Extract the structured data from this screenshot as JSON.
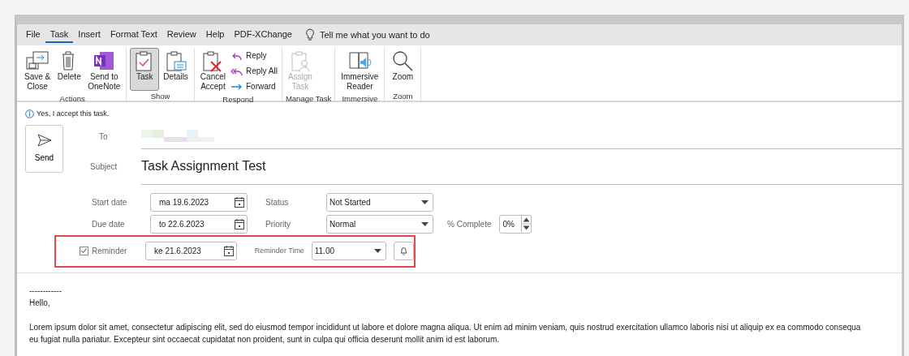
{
  "menu_tabs": [
    {
      "label": "File",
      "selected": false
    },
    {
      "label": "Task",
      "selected": true
    },
    {
      "label": "Insert",
      "selected": false
    },
    {
      "label": "Format Text",
      "selected": false
    },
    {
      "label": "Review",
      "selected": false
    },
    {
      "label": "Help",
      "selected": false
    },
    {
      "label": "PDF-XChange",
      "selected": false
    }
  ],
  "tell_me": {
    "placeholder": "Tell me what you want to do"
  },
  "ribbon_groups": [
    {
      "label": "Actions",
      "buttons": [
        {
          "kind": "large",
          "label": "Save &\nClose",
          "selected": false,
          "disabled": false
        },
        {
          "kind": "large",
          "label": "Delete",
          "selected": false,
          "disabled": false
        },
        {
          "kind": "large",
          "label": "Send to\nOneNote",
          "selected": false,
          "disabled": false
        }
      ]
    },
    {
      "label": "Show",
      "buttons": [
        {
          "kind": "large",
          "label": "Task",
          "selected": true,
          "disabled": false
        },
        {
          "kind": "large",
          "label": "Details",
          "selected": false,
          "disabled": false
        }
      ]
    },
    {
      "label": "Respond",
      "buttons": [
        {
          "kind": "large",
          "label": "Cancel\nAccept",
          "selected": false,
          "disabled": false
        },
        {
          "kind": "small",
          "label": "Reply"
        },
        {
          "kind": "small",
          "label": "Reply All"
        },
        {
          "kind": "small",
          "label": "Forward"
        }
      ]
    },
    {
      "label": "Manage Task",
      "buttons": [
        {
          "kind": "large",
          "label": "Assign\nTask",
          "selected": false,
          "disabled": true
        }
      ]
    },
    {
      "label": "Immersive",
      "buttons": [
        {
          "kind": "large",
          "label": "Immersive\nReader",
          "selected": false,
          "disabled": false
        }
      ]
    },
    {
      "label": "Zoom",
      "buttons": [
        {
          "kind": "large",
          "label": "Zoom",
          "selected": false,
          "disabled": false
        }
      ]
    }
  ],
  "info_bar": "Yes, I accept this task.",
  "send_button": "Send",
  "to": {
    "label": "To"
  },
  "subject": {
    "label": "Subject",
    "value": "Task Assignment Test"
  },
  "field_rows": [
    {
      "highlighted": false,
      "checkbox": null,
      "label": "Start date",
      "date": "ma 19.6.2023",
      "select_label": "Status",
      "select_value": "Not Started",
      "extra": null
    },
    {
      "highlighted": false,
      "checkbox": null,
      "label": "Due date",
      "date": "to 22.6.2023",
      "select_label": "Priority",
      "select_value": "Normal",
      "extra": {
        "kind": "spinner",
        "label": "% Complete",
        "value": "0%"
      }
    },
    {
      "highlighted": true,
      "checkbox": {
        "checked": true
      },
      "label": "Reminder",
      "date": "ke 21.6.2023",
      "select_label": "Reminder Time",
      "select_value": "11.00",
      "extra": {
        "kind": "bell"
      }
    }
  ],
  "body": {
    "separator": "------------",
    "greeting": "Hello,",
    "lines": [
      "Lorem ipsum dolor sit amet, consectetur adipiscing elit, sed do eiusmod tempor incididunt ut labore et dolore magna aliqua. Ut enim ad minim veniam, quis nostrud exercitation ullamco laboris nisi ut aliquip ex ea commodo consequa",
      "eu fugiat nulla pariatur. Excepteur sint occaecat cupidatat non proident, sunt in culpa qui officia deserunt mollit anim id est laborum."
    ]
  }
}
